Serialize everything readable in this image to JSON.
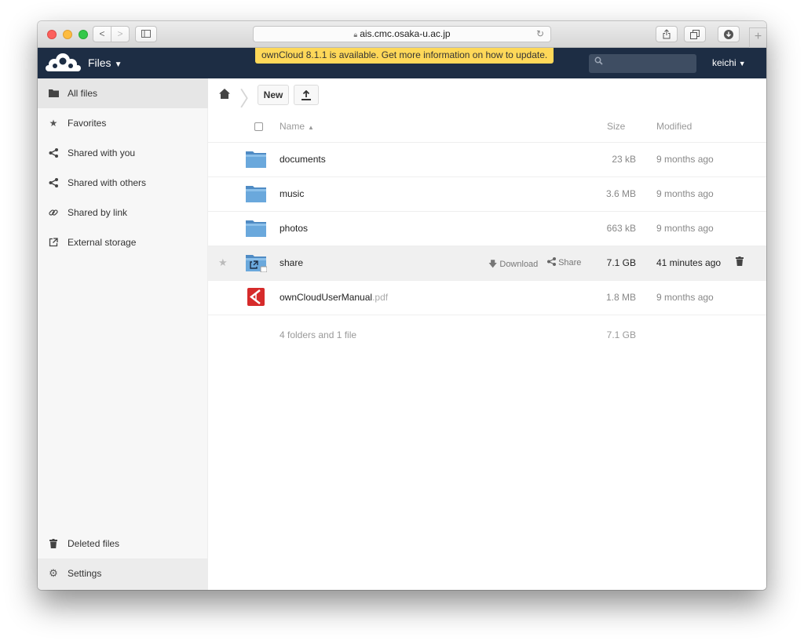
{
  "browser": {
    "url": "ais.cmc.osaka-u.ac.jp",
    "back_label": "<",
    "forward_label": ">"
  },
  "header": {
    "app_name": "Files",
    "caret": "▼",
    "update_notice": "ownCloud 8.1.1 is available. Get more information on how to update.",
    "user": "keichi",
    "user_caret": "▼"
  },
  "sidebar": {
    "items": [
      {
        "label": "All files",
        "icon": "folder-icon"
      },
      {
        "label": "Favorites",
        "icon": "star-icon"
      },
      {
        "label": "Shared with you",
        "icon": "share-icon"
      },
      {
        "label": "Shared with others",
        "icon": "share-icon"
      },
      {
        "label": "Shared by link",
        "icon": "link-icon"
      },
      {
        "label": "External storage",
        "icon": "external-icon"
      }
    ],
    "deleted": "Deleted files",
    "settings": "Settings"
  },
  "toolbar": {
    "new_label": "New"
  },
  "table": {
    "headers": {
      "name": "Name",
      "sort_arrow": "▲",
      "size": "Size",
      "modified": "Modified"
    },
    "rows": [
      {
        "name": "documents",
        "ext": "",
        "size": "23 kB",
        "modified": "9 months ago",
        "type": "folder"
      },
      {
        "name": "music",
        "ext": "",
        "size": "3.6 MB",
        "modified": "9 months ago",
        "type": "folder"
      },
      {
        "name": "photos",
        "ext": "",
        "size": "663 kB",
        "modified": "9 months ago",
        "type": "folder"
      },
      {
        "name": "share",
        "ext": "",
        "size": "7.1 GB",
        "modified": "41 minutes ago",
        "type": "external-folder",
        "download_label": "Download",
        "share_label": "Share"
      },
      {
        "name": "ownCloudUserManual",
        "ext": ".pdf",
        "size": "1.8 MB",
        "modified": "9 months ago",
        "type": "pdf"
      }
    ],
    "summary": {
      "text": "4 folders and 1 file",
      "size": "7.1 GB"
    }
  },
  "colors": {
    "header_bg": "#1d2d44",
    "banner_bg": "#fed859",
    "folder_blue": "#5b9bd5",
    "pdf_red": "#d62b2b"
  }
}
